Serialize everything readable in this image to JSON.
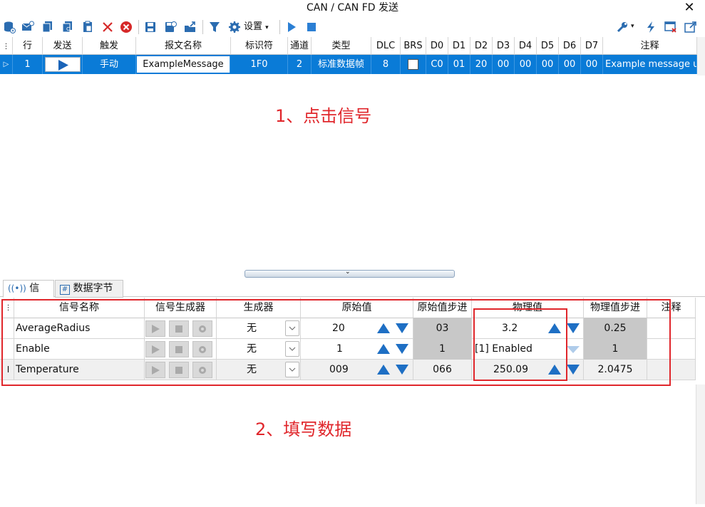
{
  "window": {
    "title": "CAN / CAN FD 发送"
  },
  "toolbar": {
    "settings_label": "设置"
  },
  "message_table": {
    "columns": [
      "行",
      "发送",
      "触发",
      "报文名称",
      "标识符",
      "通道",
      "类型",
      "DLC",
      "BRS",
      "D0",
      "D1",
      "D2",
      "D3",
      "D4",
      "D5",
      "D6",
      "D7",
      "注释"
    ],
    "row": {
      "line": "1",
      "trigger": "手动",
      "name": "ExampleMessage",
      "id": "1F0",
      "channel": "2",
      "type": "标准数据帧",
      "dlc": "8",
      "d": [
        "C0",
        "01",
        "20",
        "00",
        "00",
        "00",
        "00",
        "00"
      ],
      "comment": "Example message u"
    }
  },
  "annotations": {
    "step1": "1、点击信号",
    "step2": "2、填写数据"
  },
  "tabs": {
    "signals": "信号",
    "data_bytes": "数据字节"
  },
  "signal_table": {
    "columns": [
      "信号名称",
      "信号生成器",
      "生成器",
      "原始值",
      "原始值步进",
      "物理值",
      "物理值步进",
      "注释"
    ],
    "rows": [
      {
        "name": "AverageRadius",
        "generator": "无",
        "raw": "20",
        "raw_step": "03",
        "phys": "3.2",
        "phys_step": "0.25"
      },
      {
        "name": "Enable",
        "generator": "无",
        "raw": "1",
        "raw_step": "1",
        "phys": "[1] Enabled",
        "phys_step": "1"
      },
      {
        "name": "Temperature",
        "generator": "无",
        "raw": "009",
        "raw_step": "066",
        "phys": "250.09",
        "phys_step": "2.0475"
      }
    ]
  },
  "colors": {
    "accent": "#0a7bd7",
    "annotation": "#e0262b",
    "icon_blue": "#2b7fd4"
  }
}
